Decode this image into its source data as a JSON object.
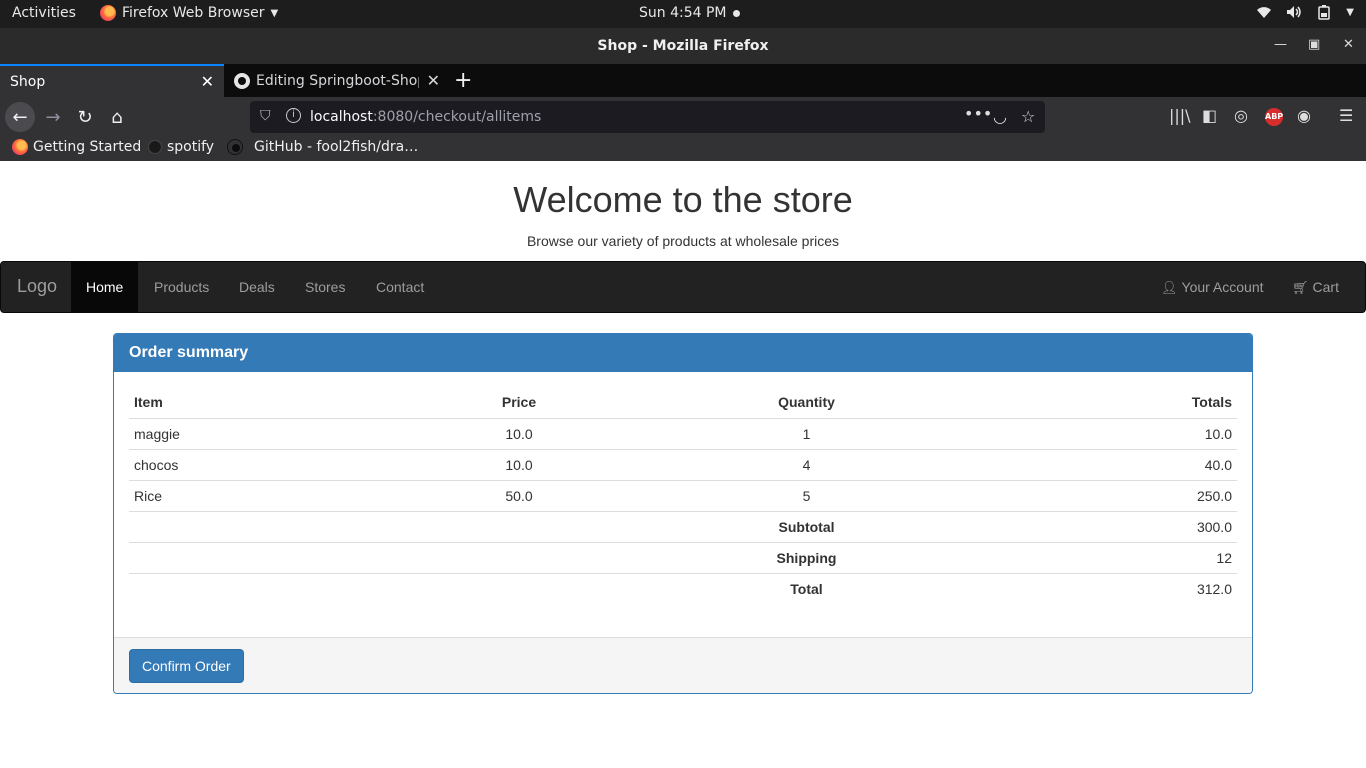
{
  "os": {
    "activities": "Activities",
    "app_menu": "Firefox Web Browser",
    "clock": "Sun  4:54 PM"
  },
  "window": {
    "title": "Shop - Mozilla Firefox"
  },
  "tabs": [
    {
      "label": "Shop",
      "active": true
    },
    {
      "label": "Editing Springboot-Shop",
      "active": false
    }
  ],
  "urlbar": {
    "host": "localhost",
    "rest": ":8080/checkout/allitems"
  },
  "bookmarks": [
    {
      "label": "Getting Started",
      "icon": "firefox-icon"
    },
    {
      "label": "spotify",
      "icon": "spotify-icon"
    },
    {
      "label": "GitHub - fool2fish/dra…",
      "icon": "github-icon"
    }
  ],
  "page": {
    "title": "Welcome to the store",
    "subtitle": "Browse our variety of products at wholesale prices"
  },
  "nav": {
    "brand": "Logo",
    "items": [
      "Home",
      "Products",
      "Deals",
      "Stores",
      "Contact"
    ],
    "account": "Your Account",
    "cart": "Cart"
  },
  "order": {
    "heading": "Order summary",
    "columns": {
      "item": "Item",
      "price": "Price",
      "quantity": "Quantity",
      "totals": "Totals"
    },
    "rows": [
      {
        "item": "maggie",
        "price": "10.0",
        "quantity": "1",
        "total": "10.0"
      },
      {
        "item": "chocos",
        "price": "10.0",
        "quantity": "4",
        "total": "40.0"
      },
      {
        "item": "Rice",
        "price": "50.0",
        "quantity": "5",
        "total": "250.0"
      }
    ],
    "summary": [
      {
        "label": "Subtotal",
        "value": "300.0"
      },
      {
        "label": "Shipping",
        "value": "12"
      },
      {
        "label": "Total",
        "value": "312.0"
      }
    ],
    "confirm_label": "Confirm Order"
  },
  "colors": {
    "primary": "#337ab7",
    "navbar": "#222222",
    "tab_accent": "#0a84ff"
  }
}
